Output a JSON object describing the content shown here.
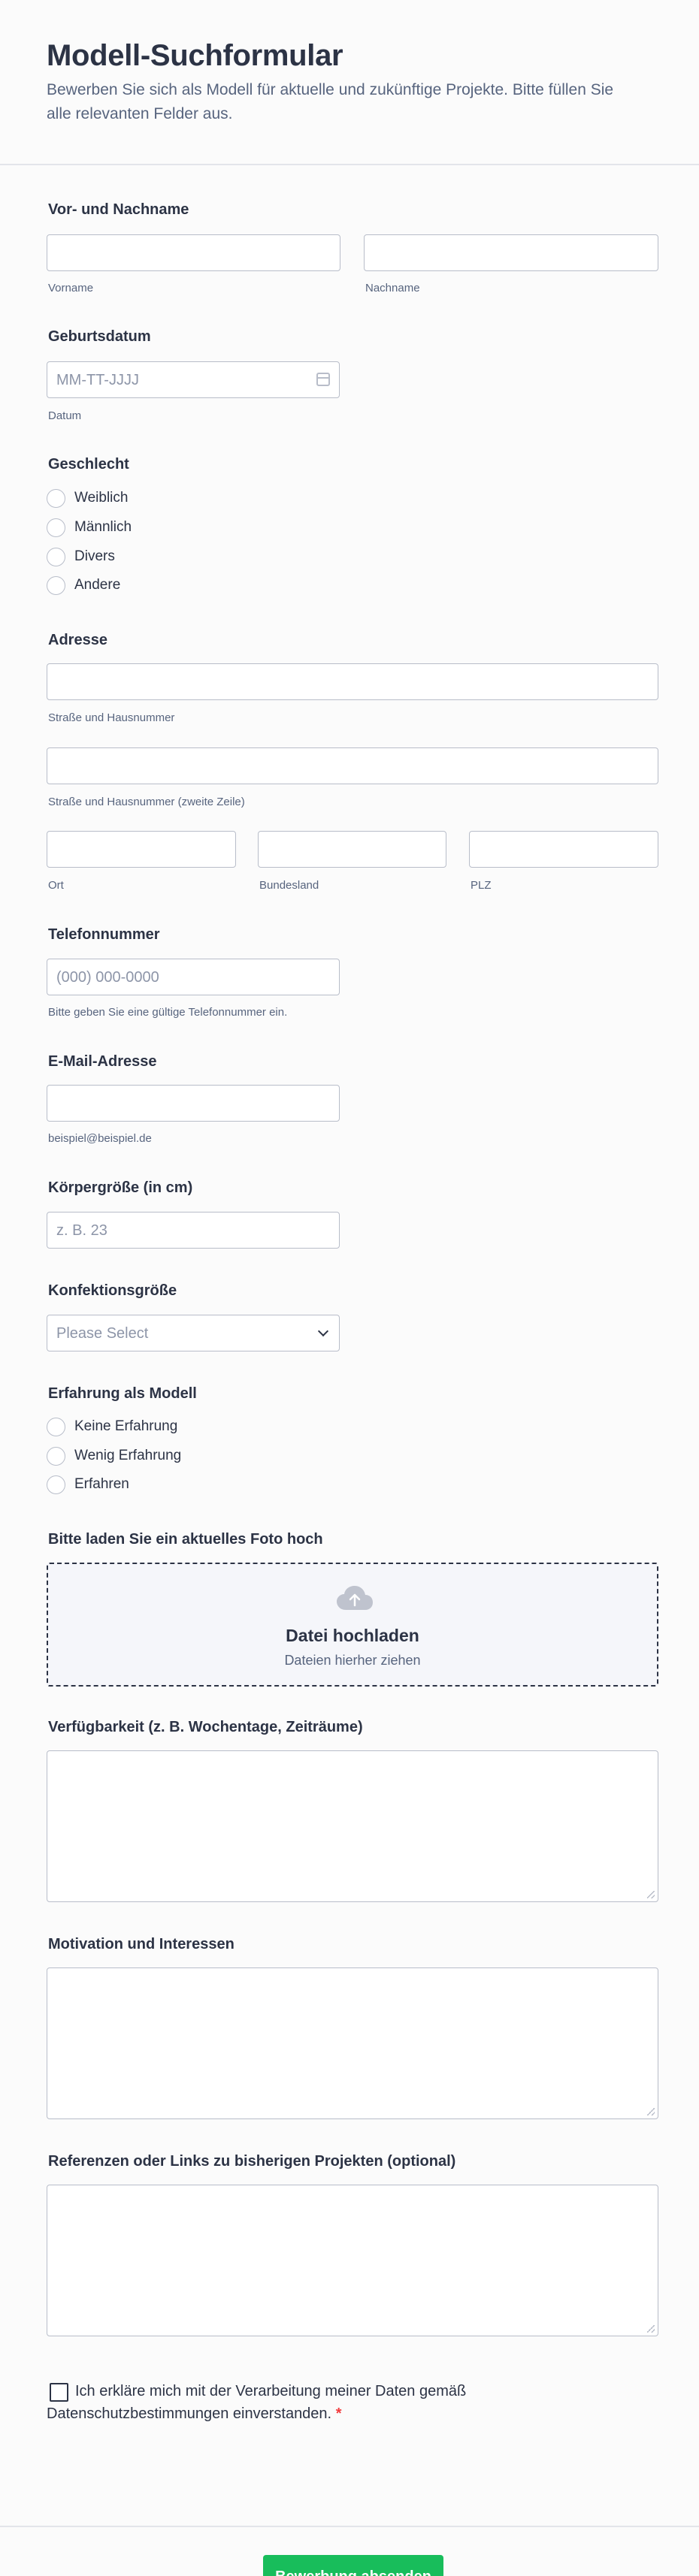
{
  "form": {
    "title": "Modell-Suchformular",
    "description": "Bewerben Sie sich als Modell für aktuelle und zukünftige Projekte. Bitte füllen Sie alle relevanten Felder aus."
  },
  "name": {
    "label": "Vor- und Nachname",
    "first_sub": "Vorname",
    "last_sub": "Nachname"
  },
  "birthdate": {
    "label": "Geburtsdatum",
    "placeholder": "MM-TT-JJJJ",
    "sub": "Datum"
  },
  "gender": {
    "label": "Geschlecht",
    "options": [
      "Weiblich",
      "Männlich",
      "Divers",
      "Andere"
    ]
  },
  "address": {
    "label": "Adresse",
    "line1_sub": "Straße und Hausnummer",
    "line2_sub": "Straße und Hausnummer (zweite Zeile)",
    "city_sub": "Ort",
    "state_sub": "Bundesland",
    "zip_sub": "PLZ"
  },
  "phone": {
    "label": "Telefonnummer",
    "placeholder": "(000) 000-0000",
    "sub": "Bitte geben Sie eine gültige Telefonnummer ein."
  },
  "email": {
    "label": "E-Mail-Adresse",
    "sub": "beispiel@beispiel.de"
  },
  "height": {
    "label": "Körpergröße (in cm)",
    "placeholder": "z. B. 23"
  },
  "size": {
    "label": "Konfektionsgröße",
    "selected": "Please Select"
  },
  "experience": {
    "label": "Erfahrung als Modell",
    "options": [
      "Keine Erfahrung",
      "Wenig Erfahrung",
      "Erfahren"
    ]
  },
  "photo": {
    "label": "Bitte laden Sie ein aktuelles Foto hoch",
    "title": "Datei hochladen",
    "hint": "Dateien hierher ziehen"
  },
  "availability": {
    "label": "Verfügbarkeit (z. B. Wochentage, Zeiträume)"
  },
  "motivation": {
    "label": "Motivation und Interessen"
  },
  "references": {
    "label": "Referenzen oder Links zu bisherigen Projekten (optional)"
  },
  "consent": {
    "text": "Ich erkläre mich mit der Verarbeitung meiner Daten gemäß Datenschutzbestimmungen einverstanden.",
    "required_mark": "*"
  },
  "submit": {
    "label": "Bewerbung absenden"
  },
  "colors": {
    "accent": "#18bd5b",
    "required": "#f23a3c",
    "text": "#2c3345",
    "muted": "#57647e",
    "border": "#b8bdc9"
  }
}
